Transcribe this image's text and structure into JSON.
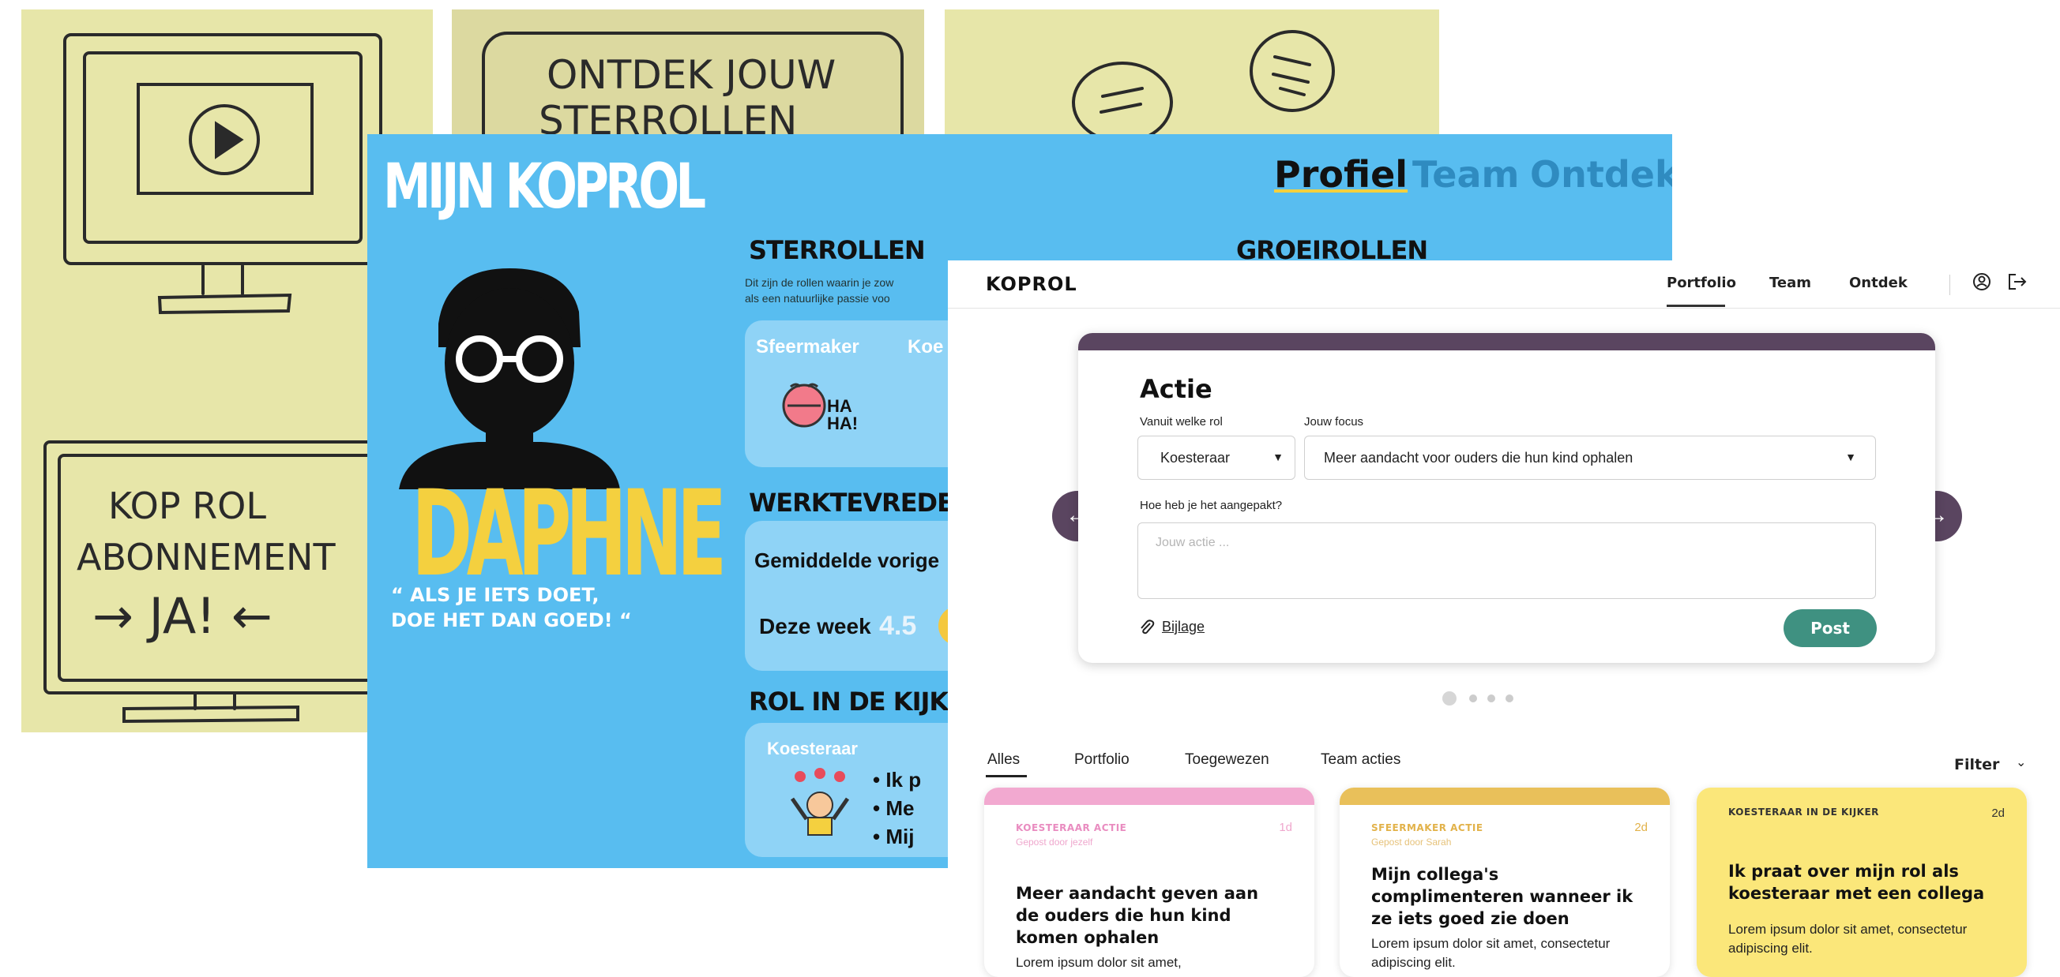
{
  "sketches": {
    "panel3_label": "ONTDEK JOUW",
    "panel3_line2": "STERROLLEN",
    "sign_lines": [
      "KOP ROL",
      "ABONNEMENT",
      "→ JA! ←"
    ]
  },
  "blue_mockup": {
    "logo": "MIJN KOPROL",
    "nav": [
      {
        "label": "Profiel",
        "color": "#111111"
      },
      {
        "label": "Team",
        "color": "#2f8bc0"
      },
      {
        "label": "Ontdek",
        "color": "#2f8bc0"
      }
    ],
    "avatar_name": "DAPHNE",
    "quote_line1": "“ ALS JE IETS DOET,",
    "quote_line2": "DOE HET DAN GOED! “",
    "sterrollen_title": "STERROLLEN",
    "sterrollen_sub1": "Dit zijn de rollen waarin je zow",
    "sterrollen_sub2": "als een natuurlijke passie voo",
    "groeirollen_title": "GROEIROLLEN",
    "roles": [
      "Sfeermaker",
      "Koe"
    ],
    "ha_label": "HA HA!",
    "werk_title": "WERKTEVREDE",
    "werk_avg": "Gemiddelde vorige",
    "werk_week_label": "Deze week",
    "werk_week_value": "4.5",
    "rol_title": "ROL IN DE KIJK",
    "rol_role": "Koesteraar",
    "rol_bullets": [
      "• Ik p",
      "• Me",
      "• Mij"
    ]
  },
  "app": {
    "logo": "KOPROL",
    "nav": [
      "Portfolio",
      "Team",
      "Ontdek"
    ],
    "active_nav": "Portfolio",
    "header_icons": [
      "user-circle-icon",
      "logout-icon"
    ],
    "composer": {
      "title": "Actie",
      "role_label": "Vanuit welke rol",
      "role_value": "Koesteraar",
      "focus_label": "Jouw focus",
      "focus_value": "Meer aandacht voor ouders die hun kind ophalen",
      "how_label": "Hoe heb je het aangepakt?",
      "action_placeholder": "Jouw actie ...",
      "attachment_label": "Bijlage",
      "post_label": "Post",
      "carousel_dots": 4,
      "active_dot": 1
    },
    "tabs": [
      "Alles",
      "Portfolio",
      "Toegewezen",
      "Team acties"
    ],
    "active_tab": "Alles",
    "filter_label": "Filter",
    "feed": [
      {
        "category": "KOESTERAAR ACTIE",
        "posted_by": "Gepost door jezelf",
        "age": "1d",
        "title": "Meer aandacht geven aan de ouders die hun kind komen ophalen",
        "body": "Lorem ipsum dolor sit amet,",
        "band": "#f2a9d0",
        "accent": "#e98cc0",
        "bg": "#ffffff"
      },
      {
        "category": "SFEERMAKER ACTIE",
        "posted_by": "Gepost door Sarah",
        "age": "2d",
        "title": "Mijn collega's complimenteren wanneer ik ze iets goed zie doen",
        "body": "Lorem ipsum dolor sit amet, consectetur adipiscing elit.",
        "band": "#e9c05a",
        "accent": "#e2b24a",
        "bg": "#ffffff"
      },
      {
        "category": "KOESTERAAR IN DE KIJKER",
        "posted_by": "",
        "age": "2d",
        "title": "Ik praat over mijn rol als koesteraar met een collega",
        "body": "Lorem ipsum dolor sit amet, consectetur adipiscing elit.",
        "band": "#fbe77a",
        "accent": "#333333",
        "bg": "#fbe77a"
      }
    ]
  }
}
